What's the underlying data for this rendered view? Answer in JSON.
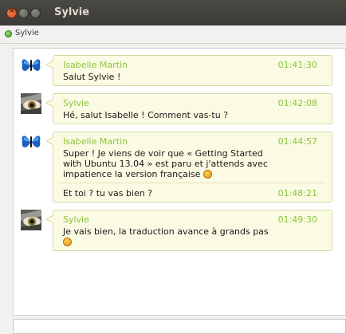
{
  "window": {
    "title": "Sylvie"
  },
  "contact": {
    "status_name": "Sylvie"
  },
  "messages": [
    {
      "sender": "Isabelle Martin",
      "time": "01:41:30",
      "text": "Salut Sylvie !",
      "avatar": "butterfly-avatar"
    },
    {
      "sender": "Sylvie",
      "time": "01:42:08",
      "text": "Hé, salut Isabelle ! Comment vas-tu ?",
      "avatar": "eye-avatar"
    },
    {
      "sender": "Isabelle Martin",
      "time": "01:44:57",
      "text_lines": [
        "Super ! Je viens de voir que « Getting Started",
        "with Ubuntu 13.04 » est paru et j'attends avec",
        "impatience la version française"
      ],
      "avatar": "butterfly-avatar",
      "followup": {
        "time": "01:48:21",
        "text": "Et toi ? tu vas bien ?"
      }
    },
    {
      "sender": "Sylvie",
      "time": "01:49:30",
      "text_lines": [
        "Je vais bien, la traduction avance à grands pas"
      ],
      "avatar": "eye-avatar"
    }
  ],
  "colors": {
    "accent": "#8ac33a",
    "bubble": "#fbfbe3",
    "titlebar": "#3b3a36"
  }
}
